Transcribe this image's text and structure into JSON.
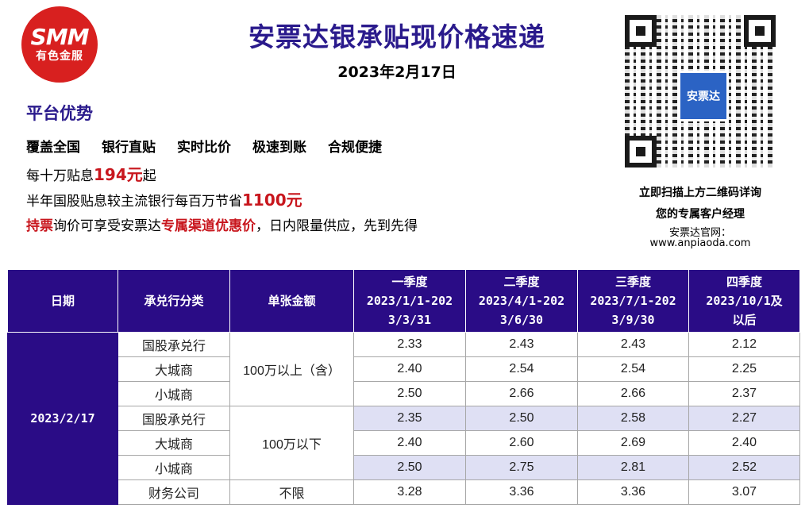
{
  "logo": {
    "main": "SMM",
    "sub": "有色金服"
  },
  "header": {
    "title": "安票达银承贴现价格速递",
    "date": "2023年2月17日"
  },
  "advantages": {
    "title": "平台优势",
    "features": [
      "覆盖全国",
      "银行直贴",
      "实时比价",
      "极速到账",
      "合规便捷"
    ],
    "line1": {
      "pre": "每十万贴息",
      "value": "194元",
      "post": "起"
    },
    "line2": {
      "pre": "半年国股贴息较主流银行每百万节省",
      "value": "1100元"
    },
    "line3": {
      "a": "持票",
      "b": "询价可享受安票达",
      "c": "专属渠道优惠价",
      "d": "，日内限量供应，先到先得"
    }
  },
  "qr": {
    "center_label": "安票达",
    "text1": "立即扫描上方二维码详询",
    "text2": "您的专属客户经理",
    "text3": "安票达官网：",
    "text4": "www.anpiaoda.com"
  },
  "table": {
    "headers": [
      "日期",
      "承兑行分类",
      "单张金额",
      "一季度\n2023/1/1-202\n3/3/31",
      "二季度\n2023/4/1-202\n3/6/30",
      "三季度\n2023/7/1-202\n3/9/30",
      "四季度\n2023/10/1及\n以后"
    ],
    "date": "2023/2/17",
    "groups": [
      {
        "amount": "100万以上（含）",
        "rows": [
          {
            "category": "国股承兑行",
            "values": [
              "2.33",
              "2.43",
              "2.43",
              "2.12"
            ]
          },
          {
            "category": "大城商",
            "values": [
              "2.40",
              "2.54",
              "2.54",
              "2.25"
            ]
          },
          {
            "category": "小城商",
            "values": [
              "2.50",
              "2.66",
              "2.66",
              "2.37"
            ]
          }
        ]
      },
      {
        "amount": "100万以下",
        "rows": [
          {
            "category": "国股承兑行",
            "values": [
              "2.35",
              "2.50",
              "2.58",
              "2.27"
            ]
          },
          {
            "category": "大城商",
            "values": [
              "2.40",
              "2.60",
              "2.69",
              "2.40"
            ]
          },
          {
            "category": "小城商",
            "values": [
              "2.50",
              "2.75",
              "2.81",
              "2.52"
            ]
          }
        ]
      },
      {
        "amount": "不限",
        "rows": [
          {
            "category": "财务公司",
            "values": [
              "3.28",
              "3.36",
              "3.36",
              "3.07"
            ]
          }
        ]
      }
    ]
  }
}
